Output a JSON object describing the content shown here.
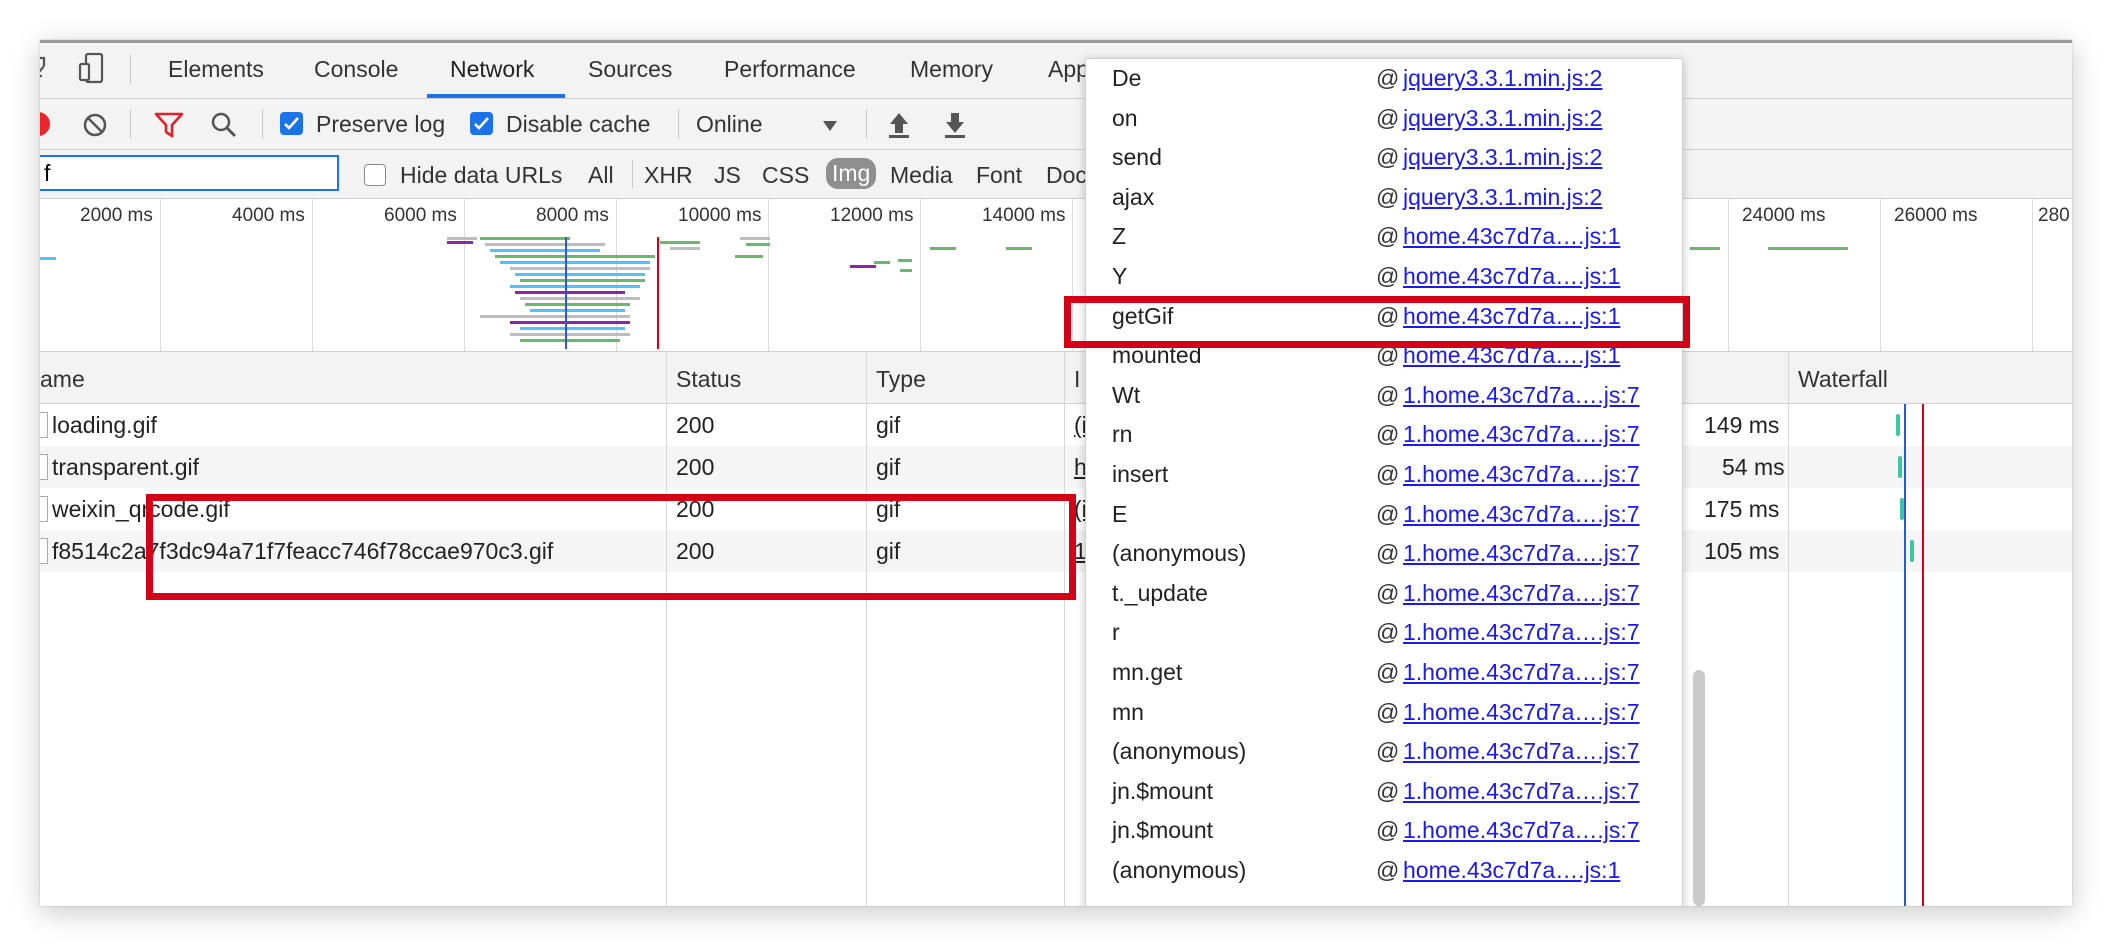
{
  "tabs": [
    "Elements",
    "Console",
    "Network",
    "Sources",
    "Performance",
    "Memory",
    "App"
  ],
  "active_tab": "Network",
  "toolbar": {
    "preserve_log": "Preserve log",
    "disable_cache": "Disable cache",
    "throttle": "Online"
  },
  "filter": {
    "value": "f",
    "hide_data_urls": "Hide data URLs",
    "types": [
      "All",
      "XHR",
      "JS",
      "CSS",
      "Img",
      "Media",
      "Font",
      "Doc"
    ],
    "active_type": "Img"
  },
  "overview": {
    "ticks": [
      "2000 ms",
      "4000 ms",
      "6000 ms",
      "8000 ms",
      "10000 ms",
      "12000 ms",
      "14000 ms",
      "24000 ms",
      "26000 ms",
      "280"
    ]
  },
  "table": {
    "headers": {
      "name": "ame",
      "status": "Status",
      "type": "Type",
      "initiator": "I",
      "waterfall": "Waterfall"
    },
    "rows": [
      {
        "name": "loading.gif",
        "status": "200",
        "type": "gif",
        "initiator": "(i",
        "time": "149 ms"
      },
      {
        "name": "transparent.gif",
        "status": "200",
        "type": "gif",
        "initiator": "h",
        "time": "54 ms"
      },
      {
        "name": "weixin_qrcode.gif",
        "status": "200",
        "type": "gif",
        "initiator": "(i",
        "time": "175 ms"
      },
      {
        "name": "f8514c2a7f3dc94a71f7feacc746f78ccae970c3.gif",
        "status": "200",
        "type": "gif",
        "initiator": "1",
        "time": "105 ms"
      }
    ]
  },
  "stack": [
    {
      "fn": "De",
      "src": "jquery3.3.1.min.js:2"
    },
    {
      "fn": "on",
      "src": "jquery3.3.1.min.js:2"
    },
    {
      "fn": "send",
      "src": "jquery3.3.1.min.js:2"
    },
    {
      "fn": "ajax",
      "src": "jquery3.3.1.min.js:2"
    },
    {
      "fn": "Z",
      "src": "home.43c7d7a….js:1"
    },
    {
      "fn": "Y",
      "src": "home.43c7d7a….js:1"
    },
    {
      "fn": "getGif",
      "src": "home.43c7d7a….js:1"
    },
    {
      "fn": "mounted",
      "src": "home.43c7d7a….js:1"
    },
    {
      "fn": "Wt",
      "src": "1.home.43c7d7a….js:7"
    },
    {
      "fn": "rn",
      "src": "1.home.43c7d7a….js:7"
    },
    {
      "fn": "insert",
      "src": "1.home.43c7d7a….js:7"
    },
    {
      "fn": "E",
      "src": "1.home.43c7d7a….js:7"
    },
    {
      "fn": "(anonymous)",
      "src": "1.home.43c7d7a….js:7"
    },
    {
      "fn": "t._update",
      "src": "1.home.43c7d7a….js:7"
    },
    {
      "fn": "r",
      "src": "1.home.43c7d7a….js:7"
    },
    {
      "fn": "mn.get",
      "src": "1.home.43c7d7a….js:7"
    },
    {
      "fn": "mn",
      "src": "1.home.43c7d7a….js:7"
    },
    {
      "fn": "(anonymous)",
      "src": "1.home.43c7d7a….js:7"
    },
    {
      "fn": "jn.$mount",
      "src": "1.home.43c7d7a….js:7"
    },
    {
      "fn": "jn.$mount",
      "src": "1.home.43c7d7a….js:7"
    },
    {
      "fn": "(anonymous)",
      "src": "home.43c7d7a….js:1"
    }
  ],
  "at_sign": "@",
  "colors": {
    "accent": "#1a73e8",
    "highlight": "#d40017",
    "link": "#1a1aee"
  }
}
